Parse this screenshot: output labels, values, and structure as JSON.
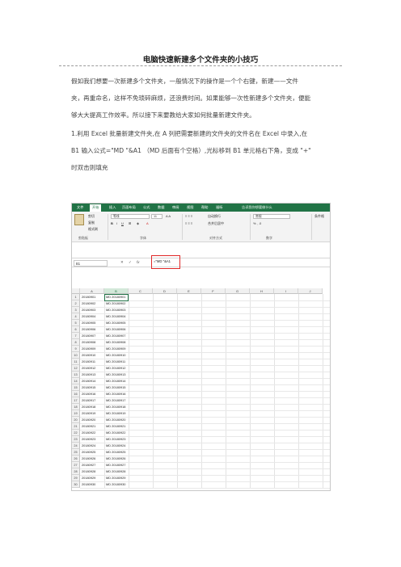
{
  "article": {
    "title": "电脑快速新建多个文件夹的小技巧",
    "paragraph1": [
      "假如我们想要一次新建多个文件夹，一般情况下的操作是一个个右键，新建——文件",
      "夹，再重命名，这样不免琐碎麻烦，还浪费时间。如果能够一次性新建多个文件夹，便能",
      "够大大提高工作效率。所以接下来要教给大家如何批量新建文件夹。"
    ],
    "paragraph2": [
      "1.利用 Excel 批量新建文件夹,在 A 列把需要新建的文件夹的文件名在 Excel 中录入,在",
      "B1 输入公式=\"MD \"&A1 （MD 后面有个空格）,光标移到 B1 单元格右下角，变成 \"+\"",
      "时双击则填充"
    ]
  },
  "excel": {
    "tabs": [
      "文件",
      "开始",
      "插入",
      "页面布局",
      "公式",
      "数据",
      "审阅",
      "视图",
      "帮助",
      "福昕"
    ],
    "tell_me": "告诉我你想要做什么",
    "ribbon": {
      "cut": "剪切",
      "copy": "复制",
      "format_painter": "格式刷",
      "font_name": "等线",
      "font_size": "11",
      "wrap_text": "自动换行",
      "merge_center": "合并后居中",
      "number_format": "常规",
      "conditional": "条件格",
      "groups": [
        "剪贴板",
        "字体",
        "对齐方式",
        "数字"
      ]
    },
    "name_box": "B1",
    "formula": "=\"MD \"&A1",
    "columns": [
      "A",
      "B",
      "C",
      "D",
      "E",
      "F",
      "G",
      "H",
      "I",
      "J"
    ],
    "rows": [
      {
        "n": "1",
        "a": "20180901",
        "b": "MD 20180901"
      },
      {
        "n": "2",
        "a": "20180902",
        "b": "MD 20180902"
      },
      {
        "n": "3",
        "a": "20180903",
        "b": "MD 20180903"
      },
      {
        "n": "4",
        "a": "20180904",
        "b": "MD 20180904"
      },
      {
        "n": "5",
        "a": "20180905",
        "b": "MD 20180905"
      },
      {
        "n": "6",
        "a": "20180906",
        "b": "MD 20180906"
      },
      {
        "n": "7",
        "a": "20180907",
        "b": "MD 20180907"
      },
      {
        "n": "8",
        "a": "20180908",
        "b": "MD 20180908"
      },
      {
        "n": "9",
        "a": "20180909",
        "b": "MD 20180909"
      },
      {
        "n": "10",
        "a": "20180910",
        "b": "MD 20180910"
      },
      {
        "n": "11",
        "a": "20180911",
        "b": "MD 20180911"
      },
      {
        "n": "12",
        "a": "20180912",
        "b": "MD 20180912"
      },
      {
        "n": "13",
        "a": "20180913",
        "b": "MD 20180913"
      },
      {
        "n": "14",
        "a": "20180914",
        "b": "MD 20180914"
      },
      {
        "n": "15",
        "a": "20180915",
        "b": "MD 20180915"
      },
      {
        "n": "16",
        "a": "20180916",
        "b": "MD 20180916"
      },
      {
        "n": "17",
        "a": "20180917",
        "b": "MD 20180917"
      },
      {
        "n": "18",
        "a": "20180918",
        "b": "MD 20180918"
      },
      {
        "n": "19",
        "a": "20180919",
        "b": "MD 20180919"
      },
      {
        "n": "20",
        "a": "20180920",
        "b": "MD 20180920"
      },
      {
        "n": "21",
        "a": "20180921",
        "b": "MD 20180921"
      },
      {
        "n": "22",
        "a": "20180922",
        "b": "MD 20180922"
      },
      {
        "n": "23",
        "a": "20180923",
        "b": "MD 20180923"
      },
      {
        "n": "24",
        "a": "20180924",
        "b": "MD 20180924"
      },
      {
        "n": "25",
        "a": "20180925",
        "b": "MD 20180925"
      },
      {
        "n": "26",
        "a": "20180926",
        "b": "MD 20180926"
      },
      {
        "n": "27",
        "a": "20180927",
        "b": "MD 20180927"
      },
      {
        "n": "28",
        "a": "20180928",
        "b": "MD 20180928"
      },
      {
        "n": "29",
        "a": "20180929",
        "b": "MD 20180929"
      },
      {
        "n": "30",
        "a": "20180930",
        "b": "MD 20180930"
      }
    ],
    "colors": {
      "accent": "#217346",
      "highlight": "#e02828"
    }
  }
}
